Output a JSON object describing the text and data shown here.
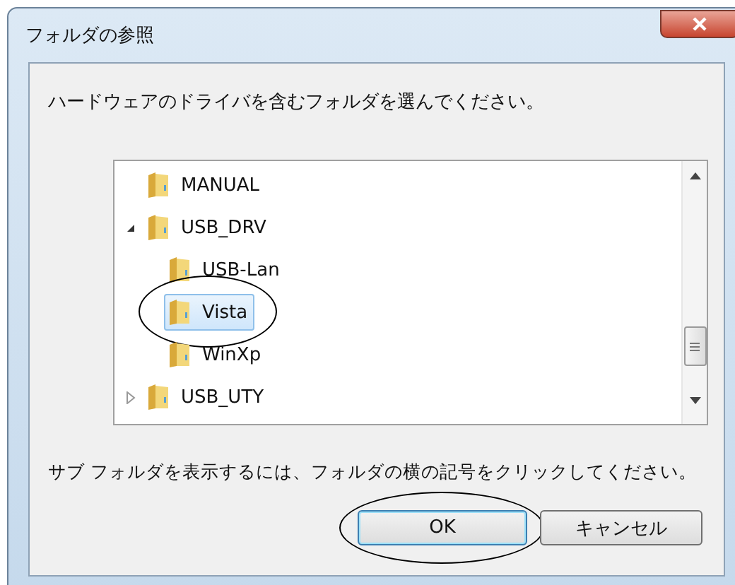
{
  "window": {
    "title": "フォルダの参照"
  },
  "instruction": "ハードウェアのドライバを含むフォルダを選んでください。",
  "tree": {
    "items": [
      {
        "label": "MANUAL",
        "selected": false,
        "circled": false
      },
      {
        "label": "USB_DRV",
        "selected": false,
        "circled": false,
        "expanded": true,
        "children": [
          {
            "label": "USB-Lan",
            "selected": false,
            "circled": false
          },
          {
            "label": "Vista",
            "selected": true,
            "circled": true
          },
          {
            "label": "WinXp",
            "selected": false,
            "circled": false
          }
        ]
      },
      {
        "label": "USB_UTY",
        "selected": false,
        "circled": false,
        "expanded": false
      }
    ]
  },
  "hint": "サブ フォルダを表示するには、フォルダの横の記号をクリックしてください。",
  "buttons": [
    {
      "label": "OK",
      "kind": "default",
      "circled": true
    },
    {
      "label": "キャンセル",
      "kind": "normal",
      "circled": false
    }
  ]
}
